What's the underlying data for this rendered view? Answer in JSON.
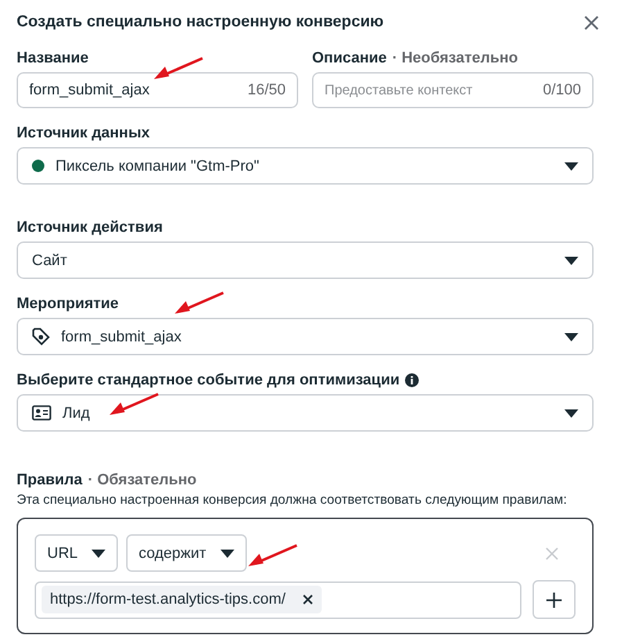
{
  "dialog": {
    "title": "Создать специально настроенную конверсию"
  },
  "name_field": {
    "label": "Название",
    "value": "form_submit_ajax",
    "counter": "16/50"
  },
  "description_field": {
    "label": "Описание",
    "note": "· Необязательно",
    "placeholder": "Предоставьте контекст",
    "counter": "0/100"
  },
  "data_source": {
    "label": "Источник данных",
    "value": "Пиксель компании \"Gtm-Pro\""
  },
  "action_source": {
    "label": "Источник действия",
    "value": "Сайт"
  },
  "event": {
    "label": "Мероприятие",
    "value": "form_submit_ajax"
  },
  "standard_event": {
    "label": "Выберите стандартное событие для оптимизации",
    "value": "Лид"
  },
  "rules": {
    "label": "Правила",
    "note": "· Обязательно",
    "description": "Эта специально настроенная конверсия должна соответствовать следующим правилам:",
    "parameter": "URL",
    "operator": "содержит",
    "values": [
      "https://form-test.analytics-tips.com/"
    ]
  }
}
